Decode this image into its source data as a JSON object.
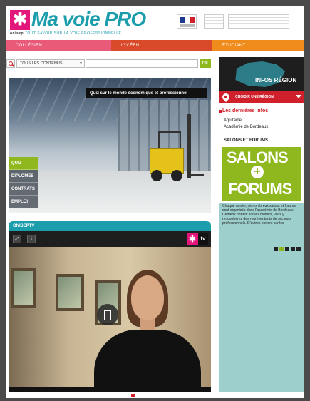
{
  "brand": {
    "logo_star": "✱",
    "logo_name": "Ma voie",
    "logo_pro": "PRO",
    "publisher": "onisep",
    "tagline": "TOUT SAVOIR SUR LA VOIE PROFESSIONNELLE"
  },
  "nav": {
    "items": [
      {
        "label": "COLLÉGIEN",
        "color": "#e85a78"
      },
      {
        "label": "LYCÉEN",
        "color": "#d94a2a"
      },
      {
        "label": "ÉTUDIANT",
        "color": "#f08c1c"
      }
    ]
  },
  "search": {
    "scope": "TOUS LES CONTENUS",
    "input_value": "",
    "button_label": "OK"
  },
  "hero": {
    "caption": "Quiz sur le monde économique et professionnel",
    "tabs": [
      "QUIZ",
      "DIPLÔMES",
      "CONTRATS",
      "EMPLOI"
    ],
    "active_tab": "QUIZ"
  },
  "tv": {
    "heading": "ONISEPTV",
    "share_icon": "share-icon",
    "info_label": "i",
    "logo_star": "✱",
    "logo_tv": "tv"
  },
  "sidebar": {
    "region_title": "INFOS RÉGION",
    "region_select_label": "CHOISIR UNE RÉGION",
    "news_title": "Les dernières infos",
    "news_region": "Aquitaine",
    "news_academy": "Académie de Bordeaux",
    "section_title": "SALONS ET FORUMS",
    "promo_word1": "SALONS",
    "promo_plus": "+",
    "promo_word2": "FORUMS",
    "description": "Chaque année, de nombreux salons et forums sont organisés dans l'académie de Bordeaux. Certains portent sur les métiers, vous y rencontrerez des représentants de secteurs professionnels. D'autres portent sur les"
  },
  "colors": {
    "brand_teal": "#1b9dac",
    "brand_pink": "#e3177b",
    "accent_green": "#8fb81e",
    "accent_red": "#d0202b"
  }
}
